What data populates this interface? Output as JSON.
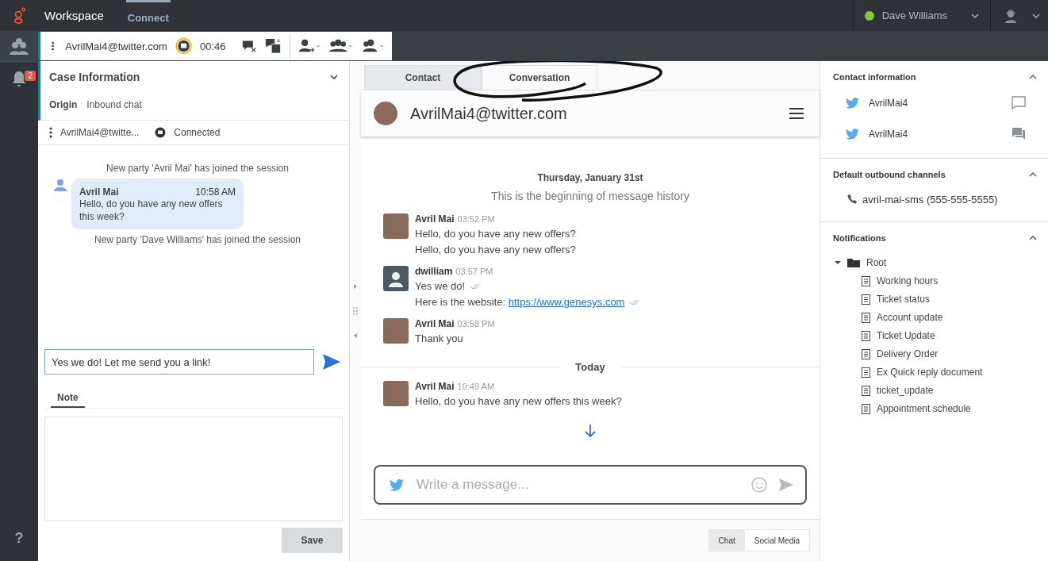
{
  "topbar": {
    "app_title": "Workspace",
    "nav": [
      {
        "label": "Connect",
        "selected": true
      }
    ],
    "user": {
      "name": "Dave Williams"
    }
  },
  "rail": {
    "notification_count": "2",
    "help": "?"
  },
  "interaction_bar": {
    "contact": "AvrilMai4@twitter.com",
    "timer": "00:46"
  },
  "case_info": {
    "title": "Case Information",
    "fields": [
      {
        "label": "Origin",
        "value": "Inbound chat"
      }
    ]
  },
  "party": {
    "name": "AvrilMai4@twitte...",
    "status": "Connected"
  },
  "transcript": [
    {
      "kind": "system",
      "text": "New party 'Avril Mai' has joined the session"
    },
    {
      "kind": "message",
      "author": "Avril Mai",
      "time": "10:58 AM",
      "text": "Hello, do you have any new offers this week?"
    },
    {
      "kind": "system",
      "text": "New party 'Dave Williams' has joined the session"
    }
  ],
  "reply": {
    "value": "Yes we do! Let me send you a link!"
  },
  "note": {
    "tabs": [
      {
        "label": "Note",
        "selected": true
      }
    ],
    "save": "Save"
  },
  "tabs": [
    {
      "label": "Contact",
      "selected": false
    },
    {
      "label": "Conversation",
      "selected": true
    }
  ],
  "conversation": {
    "title": "AvrilMai4@twitter.com",
    "groups": [
      {
        "date": "Thursday, January 31st",
        "subtitle": "This is the beginning of message history",
        "messages": [
          {
            "author": "Avril Mai",
            "kind": "customer",
            "time": "03:52 PM",
            "lines": [
              {
                "text": "Hello, do you have any new offers?",
                "read": false
              },
              {
                "text": "Hello, do you have any new offers?",
                "read": false
              }
            ]
          },
          {
            "author": "dwilliam",
            "kind": "agent",
            "time": "03:57 PM",
            "lines": [
              {
                "text": "Yes we do!",
                "read": true
              },
              {
                "text": "Here is the website: ",
                "link": "https://www.genesys.com",
                "read": true
              }
            ]
          },
          {
            "author": "Avril Mai",
            "kind": "customer",
            "time": "03:58 PM",
            "lines": [
              {
                "text": "Thank you",
                "read": false
              }
            ]
          }
        ]
      },
      {
        "date": "Today",
        "messages": [
          {
            "author": "Avril Mai",
            "kind": "customer",
            "time": "10:49 AM",
            "lines": [
              {
                "text": "Hello, do you have any new offers this week?",
                "read": false
              }
            ]
          }
        ]
      }
    ],
    "composer": {
      "placeholder": "Write a message..."
    },
    "channels": [
      {
        "label": "Chat",
        "selected": true
      },
      {
        "label": "Social Media",
        "selected": false
      }
    ]
  },
  "sidebar": {
    "contact_info": {
      "title": "Contact information",
      "items": [
        {
          "handle": "AvrilMai4",
          "kind": "outline"
        },
        {
          "handle": "AvrilMai4",
          "kind": "filled"
        }
      ]
    },
    "outbound": {
      "title": "Default outbound channels",
      "items": [
        {
          "label": "avril-mai-sms (555-555-5555)"
        }
      ]
    },
    "notifications": {
      "title": "Notifications",
      "tree": [
        {
          "label": "Root",
          "expanded": true,
          "children": [
            {
              "label": "Working hours"
            },
            {
              "label": "Ticket status"
            },
            {
              "label": "Account update"
            },
            {
              "label": "Ticket Update"
            },
            {
              "label": "Delivery Order"
            },
            {
              "label": "Ex Quick reply document"
            },
            {
              "label": "ticket_update"
            },
            {
              "label": "Appointment schedule"
            }
          ]
        }
      ]
    }
  }
}
